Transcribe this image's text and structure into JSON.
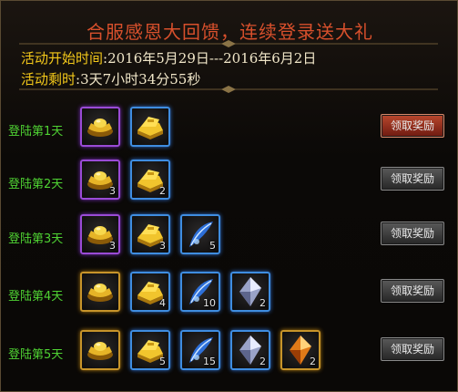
{
  "header": {
    "title": "合服感恩大回馈，连续登录送大礼",
    "start_label": "活动开始时间",
    "start_value": ":2016年5月29日---2016年6月2日",
    "remaining_label": "活动剩时",
    "remaining_value": ":3天7小时34分55秒"
  },
  "colors": {
    "title": "#d8502c",
    "label_gold": "#f3c81a",
    "day_green": "#4fd233",
    "claim_active": "#b9482e"
  },
  "rows": [
    {
      "label": "登陆第1天",
      "claim_label": "领取奖励",
      "claim_active": true,
      "items": [
        {
          "icon": "gold-ingot-icon",
          "frame": "purple",
          "count": ""
        },
        {
          "icon": "gold-bars-icon",
          "frame": "blue",
          "count": ""
        }
      ]
    },
    {
      "label": "登陆第2天",
      "claim_label": "领取奖励",
      "claim_active": false,
      "items": [
        {
          "icon": "gold-ingot-icon",
          "frame": "purple",
          "count": "3"
        },
        {
          "icon": "gold-bars-icon",
          "frame": "blue",
          "count": "2"
        }
      ]
    },
    {
      "label": "登陆第3天",
      "claim_label": "领取奖励",
      "claim_active": false,
      "items": [
        {
          "icon": "gold-ingot-icon",
          "frame": "purple",
          "count": "3"
        },
        {
          "icon": "gold-bars-icon",
          "frame": "blue",
          "count": "3"
        },
        {
          "icon": "blue-feather-icon",
          "frame": "blue",
          "count": "5"
        }
      ]
    },
    {
      "label": "登陆第4天",
      "claim_label": "领取奖励",
      "claim_active": false,
      "items": [
        {
          "icon": "gold-ingot-icon",
          "frame": "gold",
          "count": ""
        },
        {
          "icon": "gold-bars-icon",
          "frame": "blue",
          "count": "4"
        },
        {
          "icon": "blue-feather-icon",
          "frame": "blue",
          "count": "10"
        },
        {
          "icon": "silver-crystal-icon",
          "frame": "blue",
          "count": "2"
        }
      ]
    },
    {
      "label": "登陆第5天",
      "claim_label": "领取奖励",
      "claim_active": false,
      "items": [
        {
          "icon": "gold-ingot-icon",
          "frame": "gold",
          "count": ""
        },
        {
          "icon": "gold-bars-icon",
          "frame": "blue",
          "count": "5"
        },
        {
          "icon": "blue-feather-icon",
          "frame": "blue",
          "count": "15"
        },
        {
          "icon": "silver-crystal-icon",
          "frame": "blue",
          "count": "2"
        },
        {
          "icon": "orange-crystal-icon",
          "frame": "gold",
          "count": "2"
        }
      ]
    }
  ]
}
